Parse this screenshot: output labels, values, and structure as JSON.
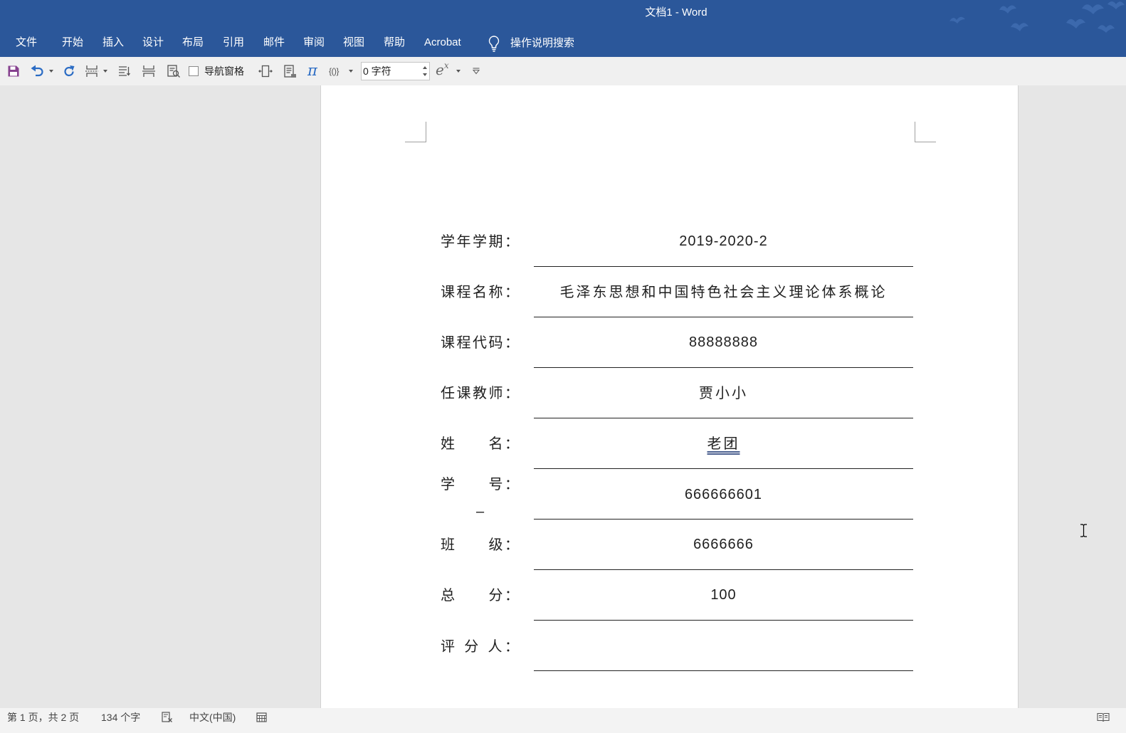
{
  "window": {
    "title": "文档1 - Word"
  },
  "ribbon": {
    "tabs": [
      {
        "label": "文件"
      },
      {
        "label": "开始"
      },
      {
        "label": "插入"
      },
      {
        "label": "设计"
      },
      {
        "label": "布局"
      },
      {
        "label": "引用"
      },
      {
        "label": "邮件"
      },
      {
        "label": "审阅"
      },
      {
        "label": "视图"
      },
      {
        "label": "帮助"
      },
      {
        "label": "Acrobat"
      }
    ],
    "tell_me": {
      "icon": "lightbulb-icon",
      "label": "操作说明搜索"
    }
  },
  "quick_access": {
    "icons": [
      "save-icon",
      "undo-icon",
      "redo-icon",
      "page-break-icon",
      "text-wrap-icon",
      "page-setup-icon",
      "print-preview-icon",
      "zoom-page-width-icon",
      "one-page-icon",
      "equation-icon",
      "brackets-icon",
      "exponent-icon",
      "customize-toolbar-icon"
    ],
    "nav_pane": {
      "label": "导航窗格",
      "checked": false
    },
    "equation_glyph": "π",
    "brackets_glyph": "{()}",
    "exponent": {
      "base": "e",
      "power": "x"
    },
    "indent": {
      "value": "0 字符"
    }
  },
  "document": {
    "fields": [
      {
        "label": "学年学期：",
        "value": "2019-2020-2"
      },
      {
        "label": "课程名称：",
        "value": "毛泽东思想和中国特色社会主义理论体系概论"
      },
      {
        "label": "课程代码：",
        "value": "88888888"
      },
      {
        "label": "任课教师：",
        "value": "贾小小"
      },
      {
        "label": "姓　　名：",
        "value": "老团"
      },
      {
        "label": "学　　号：",
        "value": "666666601",
        "extra": "–"
      },
      {
        "label": "班　　级：",
        "value": "6666666"
      },
      {
        "label": "总　　分：",
        "value": "100"
      },
      {
        "label": "评 分 人：",
        "value": ""
      }
    ]
  },
  "status_bar": {
    "page_info": "第 1 页，共 2 页",
    "word_count": "134 个字",
    "language": "中文(中国)",
    "icons": [
      "proofing-icon",
      "macro-icon",
      "read-mode-icon"
    ]
  },
  "colors": {
    "title_bar": "#2b579a",
    "title_text": "#ffffff",
    "toolbar_bg": "#f0f0f0",
    "canvas_bg": "#e6e6e6",
    "page_bg": "#ffffff",
    "text": "#1f1f1f",
    "accent_blue": "#2b6cc4",
    "save_icon": "#86418f",
    "status_bg": "#f3f3f3",
    "status_text": "#444444",
    "rule": "#222222",
    "grammar_underline": "#4a5f8f"
  }
}
